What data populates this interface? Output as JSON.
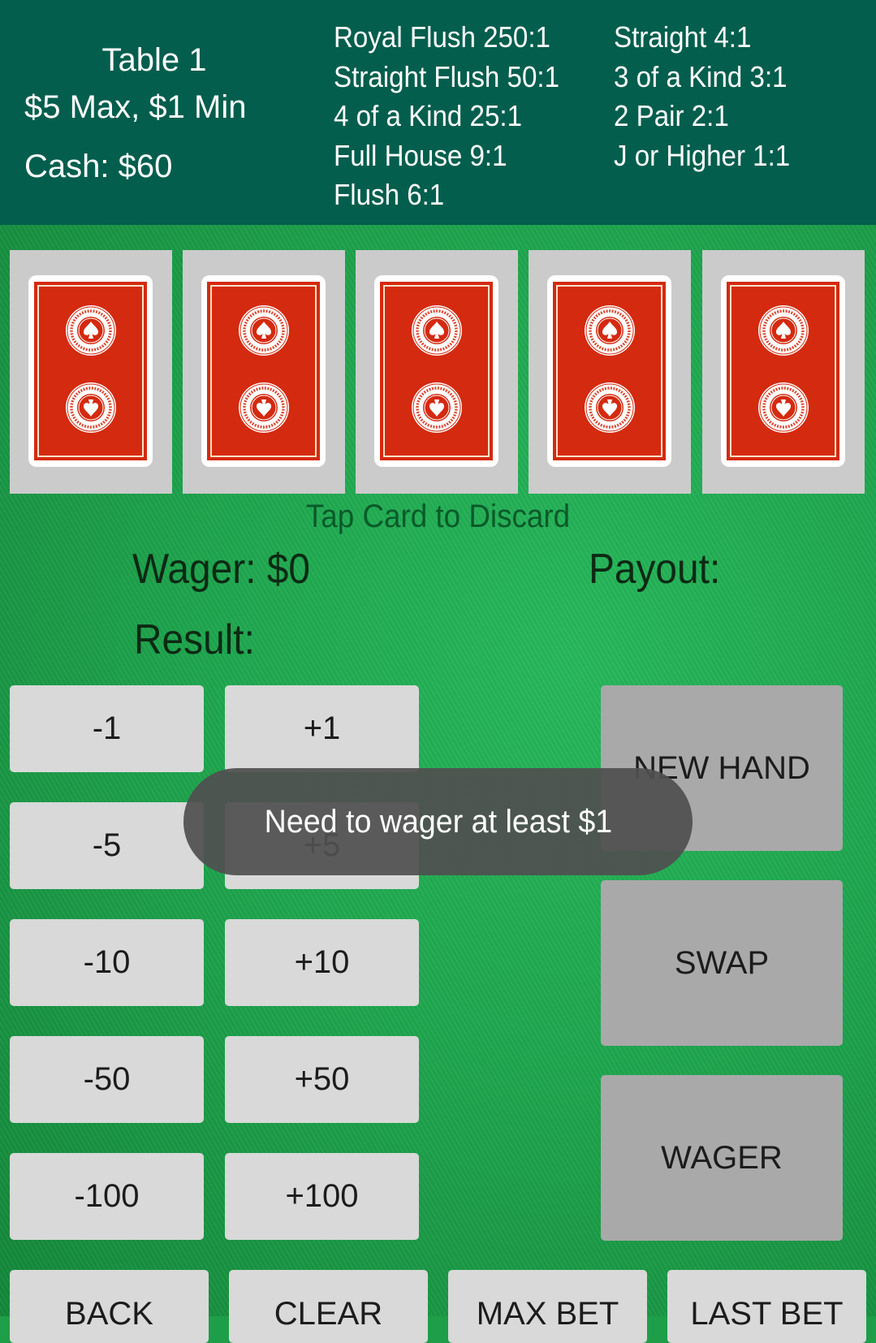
{
  "header": {
    "table_name": "Table 1",
    "limits": "$5 Max, $1 Min",
    "cash": "Cash: $60",
    "paytable_left": [
      "Royal Flush 250:1",
      "Straight Flush 50:1",
      "4 of a Kind 25:1",
      "Full House 9:1",
      "Flush 6:1"
    ],
    "paytable_right": [
      "Straight 4:1",
      "3 of a Kind 3:1",
      "2 Pair 2:1",
      "J or Higher 1:1"
    ]
  },
  "cards": [
    {
      "state": "face-down",
      "back_design": "American Contract Bridge League"
    },
    {
      "state": "face-down",
      "back_design": "American Contract Bridge League"
    },
    {
      "state": "face-down",
      "back_design": "American Contract Bridge League"
    },
    {
      "state": "face-down",
      "back_design": "American Contract Bridge League"
    },
    {
      "state": "face-down",
      "back_design": "American Contract Bridge League"
    }
  ],
  "status": {
    "hint": "Tap Card to Discard",
    "wager": "Wager: $0",
    "payout": "Payout:",
    "result": "Result:"
  },
  "adjust_buttons": {
    "minus": [
      "-1",
      "-5",
      "-10",
      "-50",
      "-100"
    ],
    "plus": [
      "+1",
      "+5",
      "+10",
      "+50",
      "+100"
    ]
  },
  "action_buttons": {
    "new_hand": "NEW HAND",
    "swap": "SWAP",
    "wager": "WAGER"
  },
  "bottom_buttons": {
    "back": "BACK",
    "clear": "CLEAR",
    "max_bet": "MAX BET",
    "last_bet": "LAST BET"
  },
  "toast": "Need to wager at least $1",
  "colors": {
    "header_bg": "#035e4d",
    "felt": "#1fa64e",
    "card_red": "#d42a10",
    "button_light": "#d8d9d8",
    "button_dark": "#a9a9a9"
  }
}
